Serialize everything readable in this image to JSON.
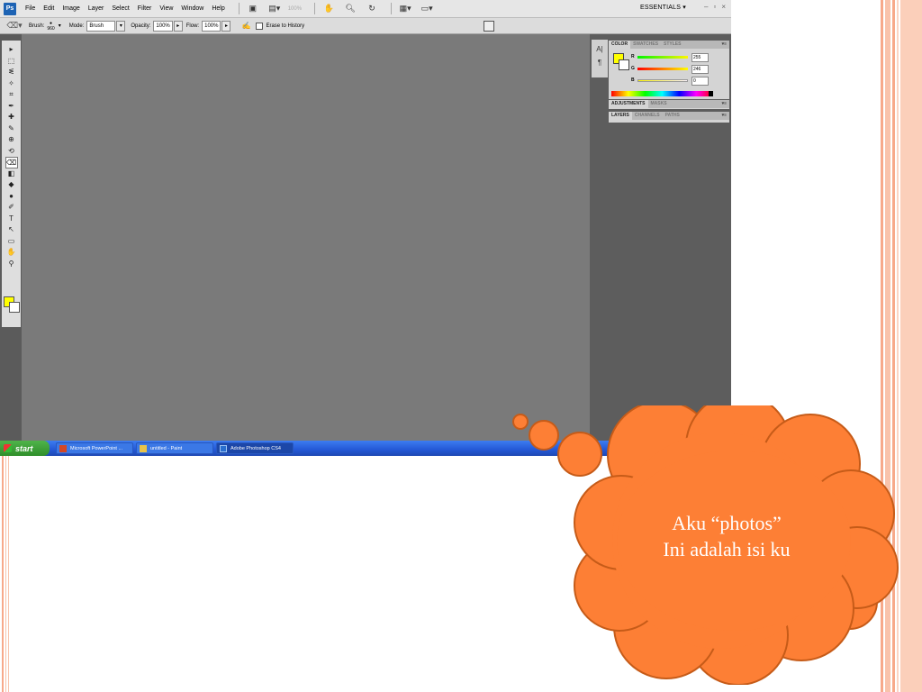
{
  "photoshop": {
    "logo": "Ps",
    "menu": [
      "File",
      "Edit",
      "Image",
      "Layer",
      "Select",
      "Filter",
      "View",
      "Window",
      "Help"
    ],
    "zoom": "100%",
    "workspace": "ESSENTIALS",
    "window_controls": [
      "–",
      "▫",
      "×"
    ],
    "options": {
      "brush_label": "Brush:",
      "brush_size": "960",
      "mode_label": "Mode:",
      "mode_value": "Brush",
      "opacity_label": "Opacity:",
      "opacity_value": "100%",
      "flow_label": "Flow:",
      "flow_value": "100%",
      "erase_history_label": "Erase to History"
    },
    "tools": [
      "move-tool",
      "marquee-tool",
      "lasso-tool",
      "magic-wand-tool",
      "crop-tool",
      "eyedropper-tool",
      "healing-brush-tool",
      "brush-tool",
      "clone-stamp-tool",
      "history-brush-tool",
      "eraser-tool",
      "gradient-tool",
      "blur-tool",
      "dodge-tool",
      "pen-tool",
      "type-tool",
      "path-selection-tool",
      "shape-tool",
      "hand-tool",
      "zoom-tool"
    ],
    "foreground_color": "#ffff00",
    "background_color": "#ffffff",
    "panels": {
      "color_tabs": [
        "COLOR",
        "SWATCHES",
        "STYLES"
      ],
      "rgb": {
        "r": "255",
        "g": "246",
        "b": "0"
      },
      "rgb_labels": {
        "r": "R",
        "g": "G",
        "b": "B"
      },
      "adjust_tabs": [
        "ADJUSTMENTS",
        "MASKS"
      ],
      "layer_tabs": [
        "LAYERS",
        "CHANNELS",
        "PATHS"
      ]
    }
  },
  "taskbar": {
    "start_label": "start",
    "tasks": [
      "Microsoft PowerPoint ...",
      "untitled - Paint",
      "Adobe Photoshop CS4"
    ]
  },
  "bubble": {
    "line1": "Aku “photos”",
    "line2": "Ini adalah isi ku",
    "fill_color": "#fd7f35",
    "stroke_color": "#c65b18"
  }
}
